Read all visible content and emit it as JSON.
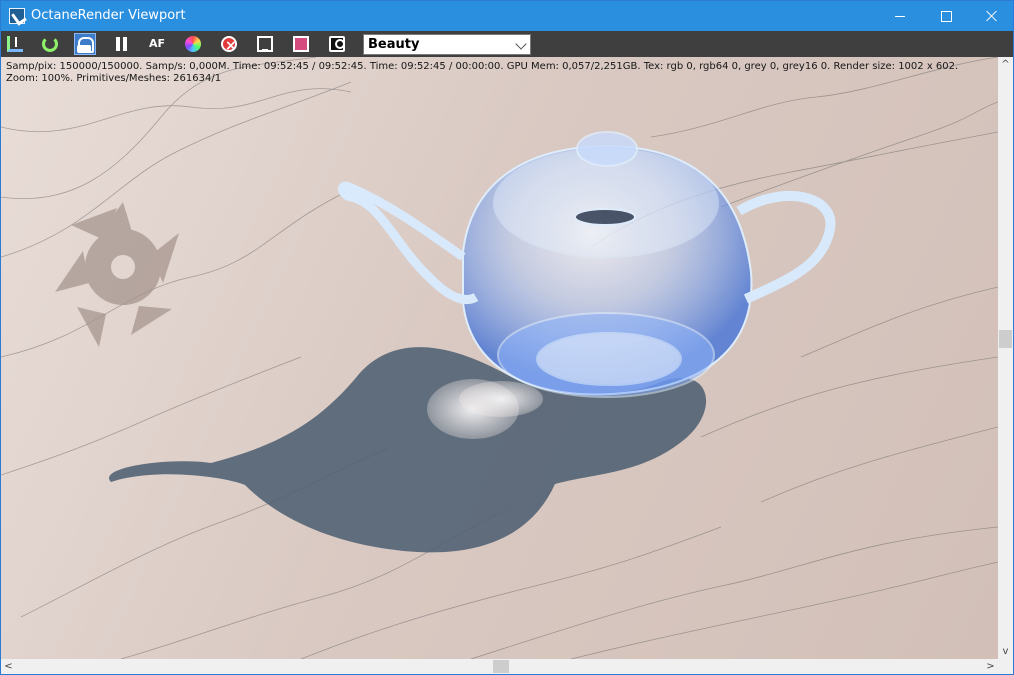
{
  "window": {
    "title": "OctaneRender Viewport",
    "accent": "#2b8fe0",
    "toolbar_background": "#3f3f3f"
  },
  "toolbar": {
    "icons": [
      "import-icon",
      "refresh-icon",
      "lock-icon",
      "pause-icon",
      "autofocus-icon",
      "color-picker-icon",
      "stop-region-icon",
      "display-icon",
      "film-icon",
      "camera-icon"
    ],
    "render_pass": "Beauty"
  },
  "status": {
    "line1": "Samp/pix: 150000/150000.   Samp/s: 0,000M.   Time: 09:52:45 / 09:52:45.   Time: 09:52:45 / 00:00:00.   GPU Mem: 0,057/2,251GB.   Tex: rgb 0, rgb64 0, grey 0, grey16 0.   Render size: 1002 x 602.",
    "line2": "Zoom: 100%.   Primitives/Meshes: 261634/1"
  },
  "scrollbars": {
    "left_arrow": "<",
    "right_arrow": ">",
    "up_arrow": "^",
    "down_arrow": "v"
  }
}
